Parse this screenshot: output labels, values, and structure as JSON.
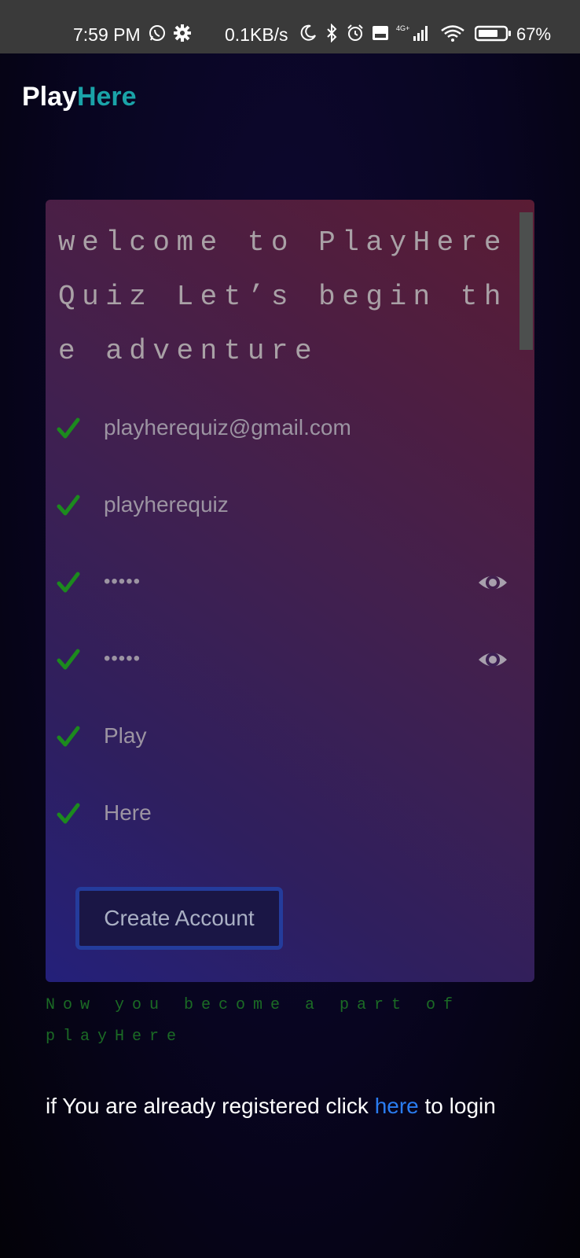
{
  "status_bar": {
    "time": "7:59 PM",
    "net_speed": "0.1KB/s",
    "battery": "67%",
    "icons": [
      "whatsapp-icon",
      "settings-icon",
      "moon-icon",
      "bluetooth-icon",
      "alarm-icon",
      "volte-icon",
      "signal-icon",
      "wifi-icon",
      "battery-icon"
    ]
  },
  "header": {
    "brand_part1": "Play",
    "brand_part2": "Here"
  },
  "card": {
    "welcome_text": "welcome to PlayHere Quiz Let’s begin the adventure",
    "fields": [
      {
        "name": "email",
        "value": "playherequiz@gmail.com",
        "valid": true
      },
      {
        "name": "username",
        "value": "playherequiz",
        "valid": true
      },
      {
        "name": "password",
        "value": "•••••",
        "valid": true,
        "has_eye": true
      },
      {
        "name": "confirm-password",
        "value": "•••••",
        "valid": true,
        "has_eye": true
      },
      {
        "name": "first-name",
        "value": "Play",
        "valid": true
      },
      {
        "name": "last-name",
        "value": "Here",
        "valid": true
      }
    ],
    "create_button_label": "Create Account"
  },
  "success_message": "Now you become a part of playHere",
  "login_prompt": {
    "prefix": "if You are already registered click ",
    "link_text": "here",
    "suffix": " to login"
  },
  "colors": {
    "brand_accent": "#1aa3a8",
    "check_green": "#1c8a1e",
    "success_text": "#1b6b25",
    "link_blue": "#2a7cf0",
    "button_border": "#243c9c"
  }
}
